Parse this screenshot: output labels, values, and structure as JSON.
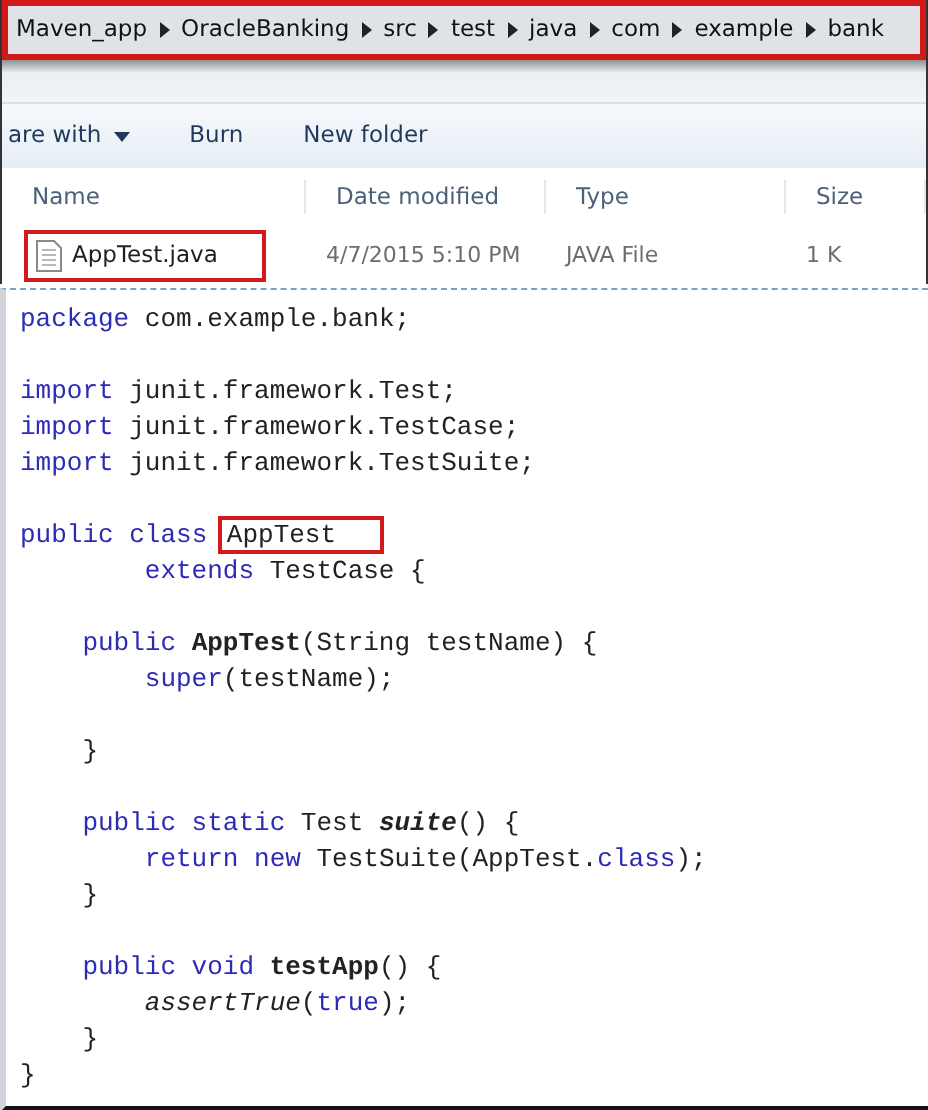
{
  "explorer": {
    "breadcrumb": [
      {
        "label": "Maven_app"
      },
      {
        "label": "OracleBanking"
      },
      {
        "label": "src"
      },
      {
        "label": "test"
      },
      {
        "label": "java"
      },
      {
        "label": "com"
      },
      {
        "label": "example"
      },
      {
        "label": "bank"
      }
    ],
    "breadcrumb_highlighted": true,
    "toolbar": [
      {
        "label": "are with",
        "dropdown": true
      },
      {
        "label": "Burn",
        "dropdown": false
      },
      {
        "label": "New folder",
        "dropdown": false
      }
    ],
    "columns": [
      "Name",
      "Date modified",
      "Type",
      "Size"
    ],
    "files": [
      {
        "name": "AppTest.java",
        "date_modified": "4/7/2015 5:10 PM",
        "type": "JAVA File",
        "size": "1 K",
        "highlighted": true
      }
    ]
  },
  "editor": {
    "lines": [
      {
        "kind": "top",
        "segments": [
          {
            "text": "package ",
            "kind": "keyword"
          },
          {
            "text": "com.example.bank;",
            "kind": "plain"
          }
        ]
      },
      {
        "kind": "blank"
      },
      {
        "kind": "top",
        "segments": [
          {
            "text": "import ",
            "kind": "keyword"
          },
          {
            "text": "junit.framework.Test;",
            "kind": "plain"
          }
        ]
      },
      {
        "kind": "top",
        "segments": [
          {
            "text": "import ",
            "kind": "keyword"
          },
          {
            "text": "junit.framework.TestCase;",
            "kind": "plain"
          }
        ]
      },
      {
        "kind": "top",
        "segments": [
          {
            "text": "import ",
            "kind": "keyword"
          },
          {
            "text": "junit.framework.TestSuite;",
            "kind": "plain"
          }
        ]
      },
      {
        "kind": "blank"
      },
      {
        "kind": "top",
        "segments": [
          {
            "text": "public class ",
            "kind": "keyword"
          },
          {
            "text": "AppTest",
            "kind": "plain",
            "boxed": true
          }
        ]
      },
      {
        "kind": "body",
        "segments": [
          {
            "text": "extends ",
            "kind": "keyword"
          },
          {
            "text": "TestCase {",
            "kind": "plain"
          }
        ]
      },
      {
        "kind": "blank"
      },
      {
        "kind": "member",
        "segments": [
          {
            "text": "public ",
            "kind": "keyword"
          },
          {
            "text": "AppTest",
            "kind": "method"
          },
          {
            "text": "(String testName) {",
            "kind": "plain"
          }
        ]
      },
      {
        "kind": "body",
        "segments": [
          {
            "text": "super",
            "kind": "keyword"
          },
          {
            "text": "(testName);",
            "kind": "plain"
          }
        ]
      },
      {
        "kind": "blank"
      },
      {
        "kind": "member",
        "segments": [
          {
            "text": "}",
            "kind": "plain"
          }
        ]
      },
      {
        "kind": "blank"
      },
      {
        "kind": "member",
        "segments": [
          {
            "text": "public static ",
            "kind": "keyword"
          },
          {
            "text": "Test ",
            "kind": "plain"
          },
          {
            "text": "suite",
            "kind": "static"
          },
          {
            "text": "() {",
            "kind": "plain"
          }
        ]
      },
      {
        "kind": "body",
        "segments": [
          {
            "text": "return new ",
            "kind": "keyword"
          },
          {
            "text": "TestSuite(AppTest.",
            "kind": "plain"
          },
          {
            "text": "class",
            "kind": "keyword"
          },
          {
            "text": ");",
            "kind": "plain"
          }
        ]
      },
      {
        "kind": "member",
        "segments": [
          {
            "text": "}",
            "kind": "plain"
          }
        ]
      },
      {
        "kind": "blank"
      },
      {
        "kind": "member",
        "segments": [
          {
            "text": "public void ",
            "kind": "keyword"
          },
          {
            "text": "testApp",
            "kind": "method"
          },
          {
            "text": "() {",
            "kind": "plain"
          }
        ]
      },
      {
        "kind": "body",
        "segments": [
          {
            "text": "assertTrue",
            "kind": "italic"
          },
          {
            "text": "(",
            "kind": "plain"
          },
          {
            "text": "true",
            "kind": "keyword"
          },
          {
            "text": ");",
            "kind": "plain"
          }
        ]
      },
      {
        "kind": "member",
        "segments": [
          {
            "text": "}",
            "kind": "plain"
          }
        ]
      },
      {
        "kind": "top",
        "segments": [
          {
            "text": "}",
            "kind": "plain"
          }
        ]
      }
    ]
  }
}
